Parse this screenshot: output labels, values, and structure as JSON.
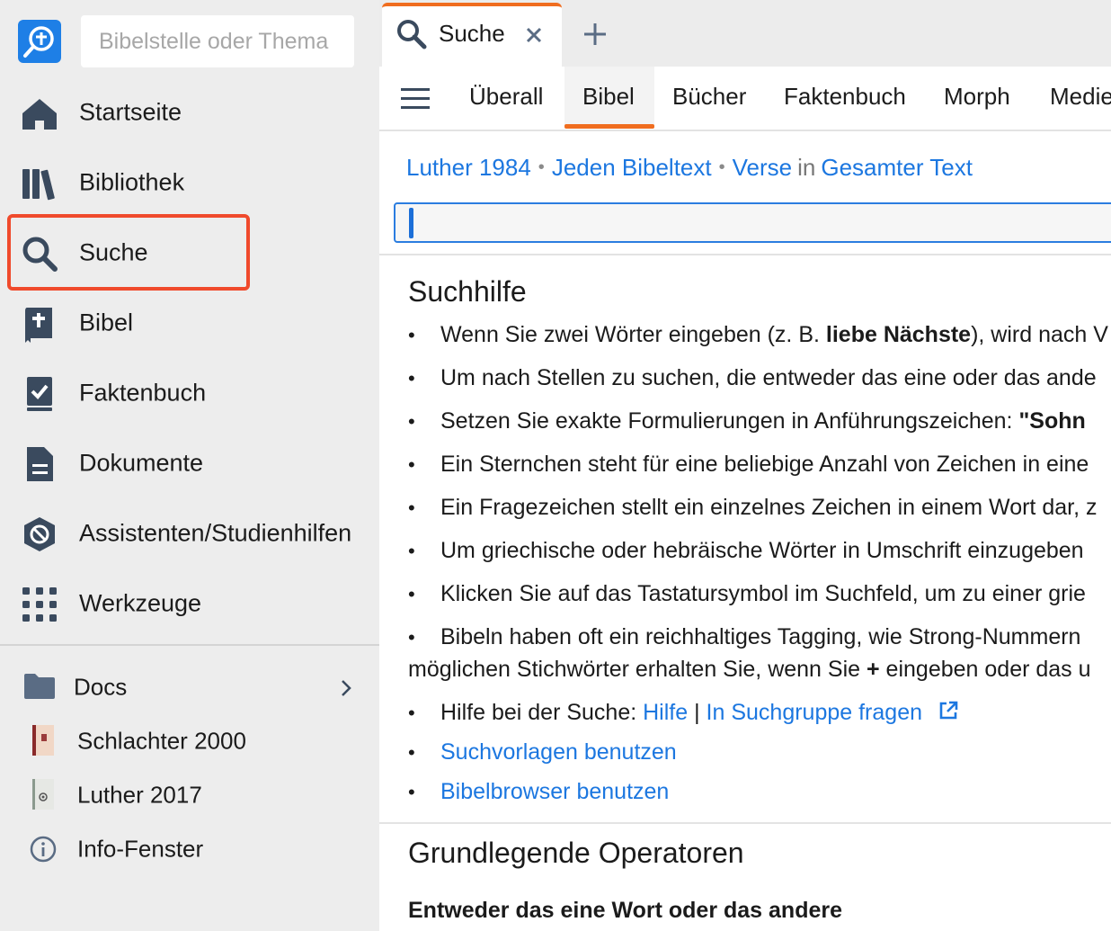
{
  "sidebar": {
    "search_placeholder": "Bibelstelle oder Thema",
    "nav": [
      {
        "label": "Startseite",
        "icon": "home-icon"
      },
      {
        "label": "Bibliothek",
        "icon": "library-icon"
      },
      {
        "label": "Suche",
        "icon": "search-icon"
      },
      {
        "label": "Bibel",
        "icon": "bible-icon"
      },
      {
        "label": "Faktenbuch",
        "icon": "factbook-icon"
      },
      {
        "label": "Dokumente",
        "icon": "document-icon"
      },
      {
        "label": "Assistenten/Studienhilfen",
        "icon": "guides-icon"
      },
      {
        "label": "Werkzeuge",
        "icon": "grid-icon"
      }
    ],
    "lower": [
      {
        "label": "Docs",
        "icon": "folder-icon"
      },
      {
        "label": "Schlachter 2000",
        "icon": "book-cover-icon"
      },
      {
        "label": "Luther 2017",
        "icon": "book-cover-icon"
      },
      {
        "label": "Info-Fenster",
        "icon": "info-icon"
      }
    ],
    "highlight_color": "#f04a2c"
  },
  "tabs": {
    "active": {
      "title": "Suche"
    }
  },
  "subnav": {
    "tabs": [
      "Überall",
      "Bibel",
      "Bücher",
      "Faktenbuch",
      "Morph",
      "Medien"
    ],
    "active_index": 1
  },
  "criteria": {
    "resource": "Luther 1984",
    "scope": "Jeden Bibeltext",
    "unit": "Verse",
    "in_word": "in",
    "range": "Gesamter Text"
  },
  "query": {
    "value": ""
  },
  "help": {
    "heading": "Suchhilfe",
    "b1_pre": "Wenn Sie zwei Wörter eingeben (z. B. ",
    "b1_bold": "liebe Nächste",
    "b1_post": "), wird nach V",
    "b2": "Um nach Stellen zu suchen, die entweder das eine oder das ande",
    "b3_pre": "Setzen Sie exakte Formulierungen in Anführungszeichen: ",
    "b3_bold": "\"Sohn",
    "b4": "Ein Sternchen steht für eine beliebige Anzahl von Zeichen in eine",
    "b5": "Ein Fragezeichen stellt ein einzelnes Zeichen in einem Wort dar, z",
    "b6": "Um griechische oder hebräische Wörter in Umschrift einzugeben",
    "b7": "Klicken Sie auf das Tastatursymbol im Suchfeld, um zu einer grie",
    "b8": "Bibeln haben oft ein reichhaltiges Tagging, wie Strong-Nummern",
    "b8_cont_pre": "möglichen Stichwörter erhalten Sie, wenn Sie ",
    "b8_cont_bold": "+",
    "b8_cont_post": " eingeben oder das u",
    "b9_pre": "Hilfe bei der Suche: ",
    "b9_link1": "Hilfe",
    "b9_sep": "|",
    "b9_link2": "In Suchgruppe fragen",
    "b10_link": "Suchvorlagen benutzen",
    "b11_link": "Bibelbrowser benutzen"
  },
  "operators": {
    "heading": "Grundlegende Operatoren",
    "subheading": "Entweder das eine Wort oder das andere"
  },
  "colors": {
    "accent": "#f06d1f",
    "link": "#1c77e0",
    "brand": "#1e7fe6"
  }
}
